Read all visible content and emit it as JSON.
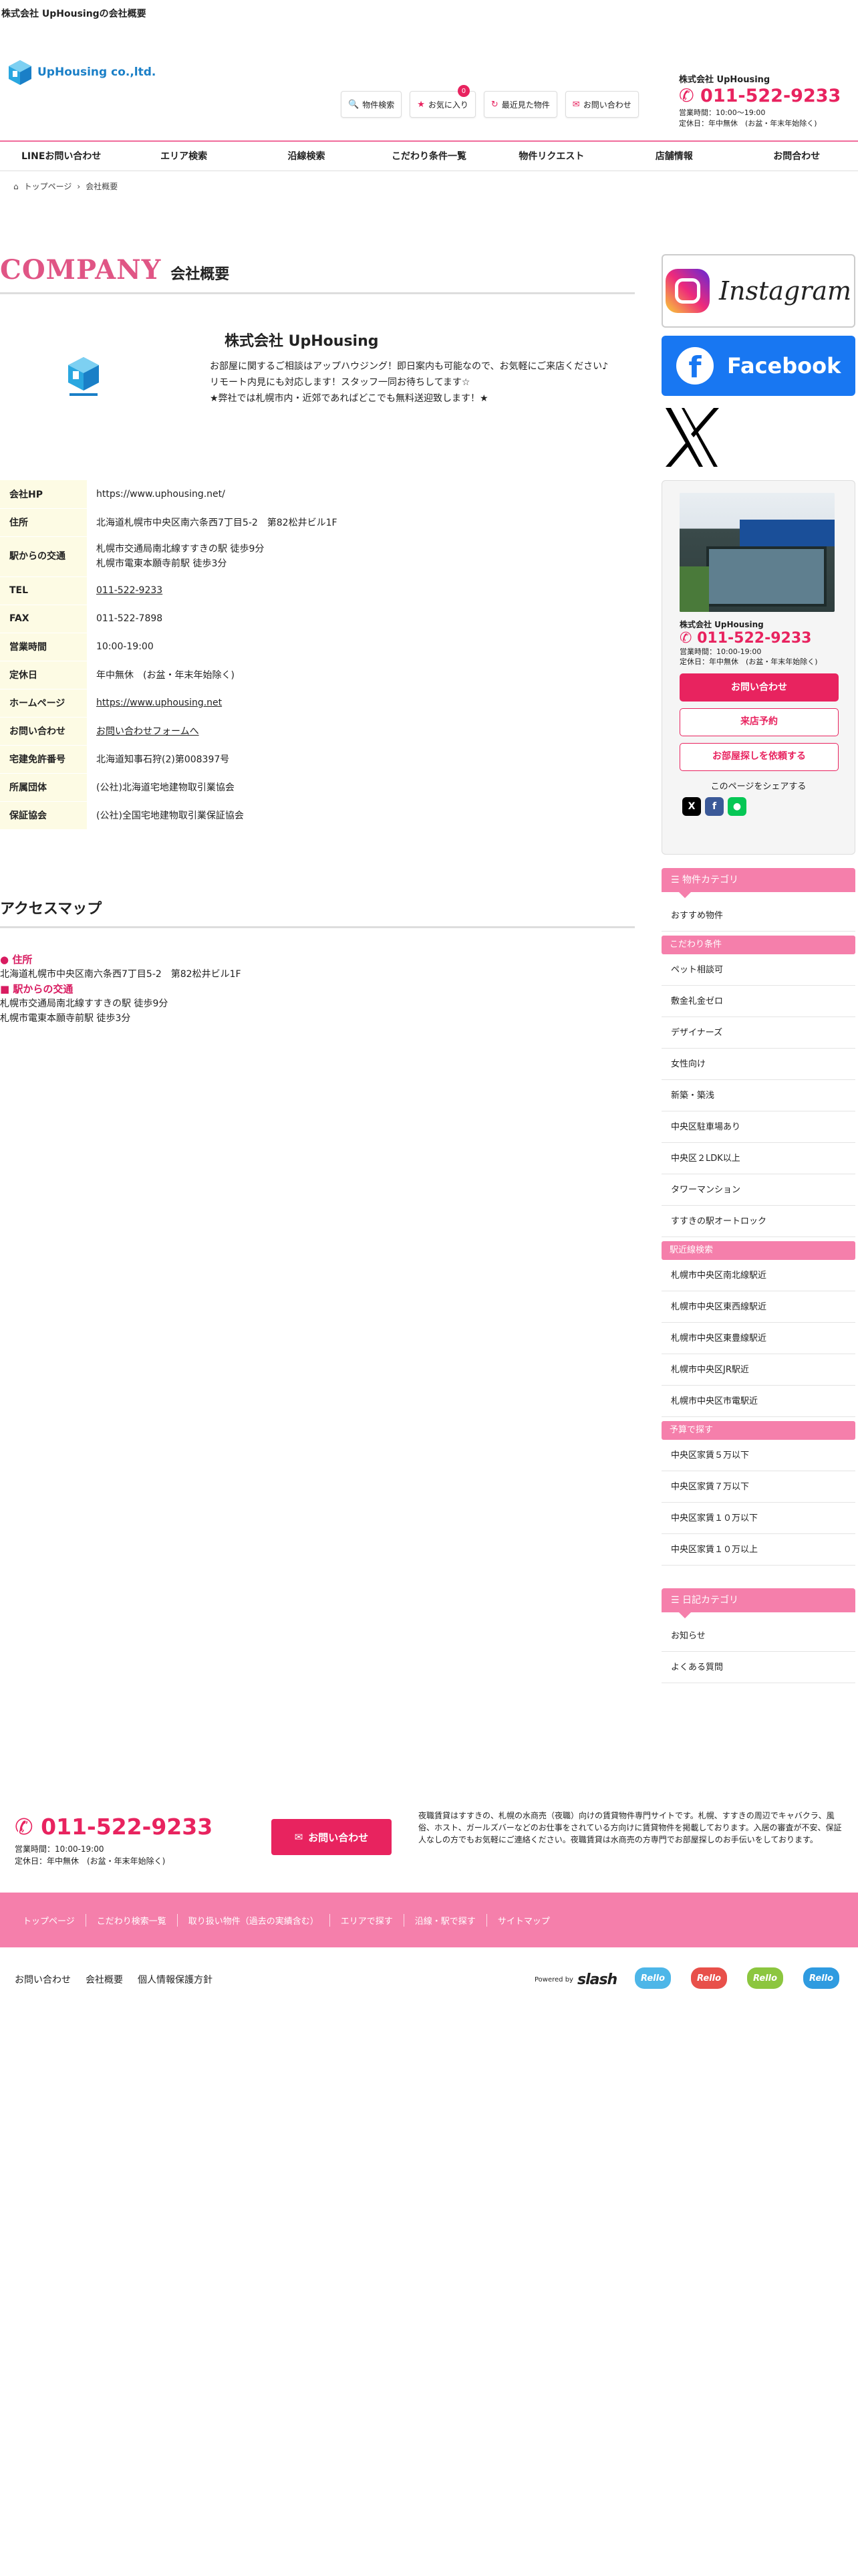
{
  "page": {
    "top_title": "株式会社 UpHousingの会社概要"
  },
  "header": {
    "logo_text": "UpHousing co.,ltd.",
    "buttons": [
      {
        "label": "物件検索",
        "icon": "search-icon"
      },
      {
        "label": "お気に入り",
        "icon": "star-icon",
        "badge": "0"
      },
      {
        "label": "最近見た物件",
        "icon": "history-icon"
      },
      {
        "label": "お問い合わせ",
        "icon": "mail-icon"
      }
    ],
    "company": "株式会社 UpHousing",
    "tel": "011-522-9233",
    "hours": "営業時間：10:00～19:00",
    "holiday": "定休日：年中無休　(お盆・年末年始除く)"
  },
  "nav": [
    "LINEお問い合わせ",
    "エリア検索",
    "沿線検索",
    "こだわり条件一覧",
    "物件リクエスト",
    "店舗情報",
    "お問合わせ"
  ],
  "breadcrumb": {
    "home": "トップページ",
    "current": "会社概要"
  },
  "company_heading": {
    "en": "COMPANY",
    "ja": "会社概要"
  },
  "intro": {
    "name": "株式会社 UpHousing",
    "lines": [
      "お部屋に関するご相談はアップハウジング！即日案内も可能なので、お気軽にご来店ください♪",
      "リモート内見にも対応します！スタッフ一同お待ちしてます☆",
      "★弊社では札幌市内・近郊であればどこでも無料送迎致します！★"
    ]
  },
  "info": [
    {
      "label": "会社HP",
      "value": "https://www.uphousing.net/"
    },
    {
      "label": "住所",
      "value": "北海道札幌市中央区南六条西7丁目5-2　第82松井ビル1F"
    },
    {
      "label": "駅からの交通",
      "value": "札幌市交通局南北線すすきの駅 徒歩9分",
      "value2": "札幌市電東本願寺前駅 徒歩3分"
    },
    {
      "label": "TEL",
      "value": "011-522-9233"
    },
    {
      "label": "FAX",
      "value": "011-522-7898"
    },
    {
      "label": "営業時間",
      "value": "10:00-19:00"
    },
    {
      "label": "定休日",
      "value": "年中無休　(お盆・年末年始除く)"
    },
    {
      "label": "ホームページ",
      "value": "https://www.uphousing.net"
    },
    {
      "label": "お問い合わせ",
      "value": "お問い合わせフォームへ"
    },
    {
      "label": "宅建免許番号",
      "value": "北海道知事石狩(2)第008397号"
    },
    {
      "label": "所属団体",
      "value": "(公社)北海道宅地建物取引業協会"
    },
    {
      "label": "保証協会",
      "value": "(公社)全国宅地建物取引業保証協会"
    }
  ],
  "access": {
    "heading": "アクセスマップ",
    "address_label": "住所",
    "address": "北海道札幌市中央区南六条西7丁目5-2　第82松井ビル1F",
    "station_label": "駅からの交通",
    "station1": "札幌市交通局南北線すすきの駅 徒歩9分",
    "station2": "札幌市電東本願寺前駅 徒歩3分"
  },
  "sidebar": {
    "instagram": "Instagram",
    "facebook": "Facebook",
    "shop": {
      "company": "株式会社 UpHousing",
      "tel": "011-522-9233",
      "hours": "営業時間：10:00-19:00",
      "holiday": "定休日：年中無休　(お盆・年末年始除く)",
      "btn_contact": "お問い合わせ",
      "btn_visit": "来店予約",
      "btn_request": "お部屋探しを依頼する",
      "share": "このページをシェアする"
    },
    "cat_heading": "物件カテゴリ",
    "cat_first": "おすすめ物件",
    "sub_kodawari": "こだわり条件",
    "kodawari": [
      "ペット相談可",
      "敷金礼金ゼロ",
      "デザイナーズ",
      "女性向け",
      "新築・築浅",
      "中央区駐車場あり",
      "中央区２LDK以上",
      "タワーマンション",
      "すすきの駅オートロック"
    ],
    "sub_line": "駅近線検索",
    "lines": [
      "札幌市中央区南北線駅近",
      "札幌市中央区東西線駅近",
      "札幌市中央区東豊線駅近",
      "札幌市中央区JR駅近",
      "札幌市中央区市電駅近"
    ],
    "sub_budget": "予算で探す",
    "budget": [
      "中央区家賃５万以下",
      "中央区家賃７万以下",
      "中央区家賃１０万以下",
      "中央区家賃１０万以上"
    ],
    "diary_heading": "日記カテゴリ",
    "diary": [
      "お知らせ",
      "よくある質問"
    ]
  },
  "footer": {
    "tel": "011-522-9233",
    "hours": "営業時間：10:00-19:00",
    "holiday": "定休日：年中無休　(お盆・年末年始除く)",
    "contact_btn": "お問い合わせ",
    "desc": "夜職賃貸はすすきの、札幌の水商売（夜職）向けの賃貸物件専門サイトです。札幌、すすきの周辺でキャバクラ、風俗、ホスト、ガールズバーなどのお仕事をされている方向けに賃貸物件を掲載しております。入居の審査が不安、保証人なしの方でもお気軽にご連絡ください。夜職賃貸は水商売の方専門でお部屋探しのお手伝いをしております。",
    "nav": [
      "トップページ",
      "こだわり検索一覧",
      "取り扱い物件（過去の実績含む）",
      "エリアで探す",
      "沿線・駅で探す",
      "サイトマップ"
    ],
    "bottom_links": [
      "お問い合わせ",
      "会社概要",
      "個人情報保護方針"
    ],
    "powered": "Powered by",
    "powered_brand": "slash",
    "badge_label": "Rello"
  }
}
